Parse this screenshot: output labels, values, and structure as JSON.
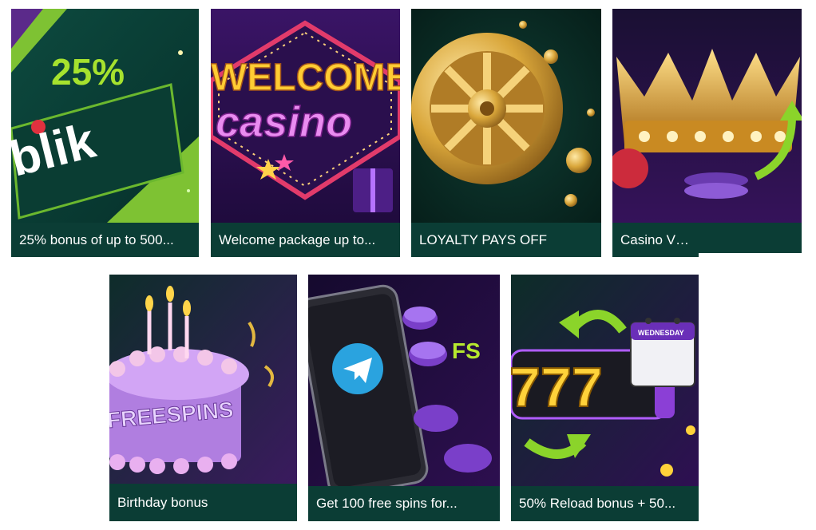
{
  "cards": [
    {
      "id": "blik",
      "title": "25% bonus of up to 500...",
      "art_text": [
        "25%",
        "blik"
      ],
      "icon": "blik-promo-image"
    },
    {
      "id": "welcome",
      "title": "Welcome package up to...",
      "art_text": [
        "WELCOME",
        "casino"
      ],
      "icon": "welcome-casino-sign-image"
    },
    {
      "id": "loyalty",
      "title": "LOYALTY PAYS OFF",
      "art_text": [],
      "icon": "golden-wheel-image"
    },
    {
      "id": "vip",
      "title": "Casino VIP Cashback",
      "art_text": [],
      "icon": "golden-crown-image"
    },
    {
      "id": "birthday",
      "title": "Birthday bonus",
      "art_text": [
        "FREESPINS"
      ],
      "icon": "birthday-cake-image"
    },
    {
      "id": "telegram",
      "title": "Get 100 free spins for...",
      "art_text": [
        "FS"
      ],
      "icon": "telegram-phone-image"
    },
    {
      "id": "reload",
      "title": "50% Reload bonus + 50...",
      "art_text": [
        "777",
        "WEDNESDAY"
      ],
      "icon": "slot-reels-calendar-image"
    }
  ],
  "colors": {
    "caption_bg": "#0b3d35",
    "caption_text": "#ffffff",
    "accent_green": "#8bd42a",
    "gold": "#d9a63a",
    "purple": "#6b2fa8"
  }
}
